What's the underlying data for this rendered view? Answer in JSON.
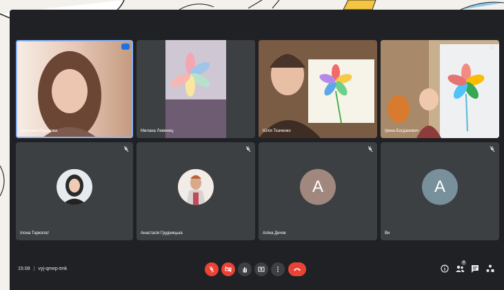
{
  "participants": [
    {
      "name": "Христина Рудакова",
      "avatar_letter": "",
      "avatar_color": ""
    },
    {
      "name": "Милана Левенец",
      "avatar_letter": "",
      "avatar_color": ""
    },
    {
      "name": "Юлія Ткаченко",
      "avatar_letter": "",
      "avatar_color": ""
    },
    {
      "name": "Ірина Богданович",
      "avatar_letter": "",
      "avatar_color": ""
    },
    {
      "name": "Ілона Таркопат",
      "avatar_letter": "",
      "avatar_color": ""
    },
    {
      "name": "Анастасія Грудницька",
      "avatar_letter": "",
      "avatar_color": ""
    },
    {
      "name": "Аліна Дичок",
      "avatar_letter": "A",
      "avatar_color": "#a1887f"
    },
    {
      "name": "Ви",
      "avatar_letter": "A",
      "avatar_color": "#78909c"
    }
  ],
  "meeting": {
    "time": "15:08",
    "separator": "|",
    "code": "vyj-qmep-tmk"
  },
  "controls": [
    "mic-off-icon",
    "camera-off-icon",
    "raise-hand-icon",
    "present-icon",
    "more-icon",
    "end-call-icon"
  ],
  "right_controls": {
    "info": "info-icon",
    "people": "people-icon",
    "people_count": "8",
    "chat": "chat-icon",
    "activities": "activities-icon"
  },
  "colors": {
    "background": "#202124",
    "tile": "#3c4043",
    "danger": "#ea4335",
    "speaking": "#8ab4f8"
  }
}
